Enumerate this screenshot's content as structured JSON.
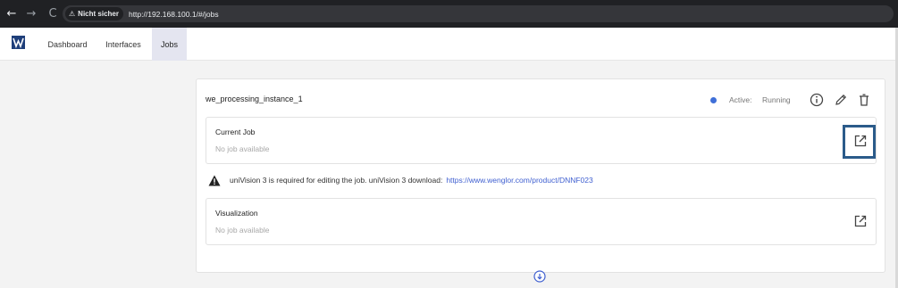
{
  "browser": {
    "security_label": "Nicht sicher",
    "url": "http://192.168.100.1/#/jobs"
  },
  "header": {
    "tabs": [
      {
        "label": "Dashboard",
        "active": false
      },
      {
        "label": "Interfaces",
        "active": false
      },
      {
        "label": "Jobs",
        "active": true
      }
    ]
  },
  "instance": {
    "name": "we_processing_instance_1",
    "status_label": "Active:",
    "status_value": "Running",
    "status_color": "#3f6fd8",
    "actions": [
      "info-icon",
      "edit-icon",
      "delete-icon"
    ]
  },
  "current_job": {
    "title": "Current Job",
    "value": "No job available"
  },
  "notice": {
    "text": "uniVision 3 is required for editing the job. uniVision 3 download:",
    "link": "https://www.wenglor.com/product/DNNF023"
  },
  "visualization": {
    "title": "Visualization",
    "value": "No job available"
  },
  "colors": {
    "accent": "#e4e5f0",
    "link": "#3f5fd0",
    "highlight_border": "#2b5b8a"
  }
}
